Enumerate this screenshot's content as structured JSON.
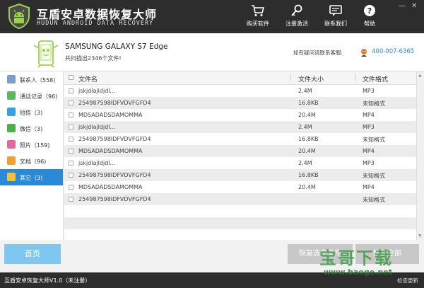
{
  "app": {
    "title_cn": "互盾安卓数据恢复大师",
    "title_en": "HUDUN ANDROID DATA RECOVERY"
  },
  "toolbar": {
    "buy": "购买软件",
    "register": "注册激活",
    "contact": "联系我们",
    "help": "帮助"
  },
  "device": {
    "name": "SAMSUNG  GALAXY S7 Edge",
    "scan_result": "共扫描出2346个文件!",
    "contact_label": "如有疑问请联系客服:",
    "phone": "400-007-6365"
  },
  "sidebar": {
    "items": [
      {
        "label": "联系人（558)",
        "icon": "contacts-icon",
        "color": "#7a9ec9"
      },
      {
        "label": "通话记录（96)",
        "icon": "phone-icon",
        "color": "#5cb85c"
      },
      {
        "label": "短信（3)",
        "icon": "sms-icon",
        "color": "#3aa0e0"
      },
      {
        "label": "微信（3)",
        "icon": "wechat-icon",
        "color": "#4cae4c"
      },
      {
        "label": "照片（159)",
        "icon": "photo-icon",
        "color": "#e06aa0"
      },
      {
        "label": "文档（96)",
        "icon": "document-icon",
        "color": "#f0a030"
      },
      {
        "label": "其它（3)",
        "icon": "other-icon",
        "color": "#f2c23a"
      }
    ],
    "active_index": 6
  },
  "table": {
    "headers": {
      "name": "文件名",
      "size": "文件大小",
      "format": "文件格式"
    },
    "rows": [
      {
        "name": "jskjdlajldjdl...",
        "size": "2.4M",
        "format": "MP3"
      },
      {
        "name": "254987598IDFVDVFGFD4",
        "size": "16.8KB",
        "format": "未知格式"
      },
      {
        "name": "MDSADADSDAMOMMA",
        "size": "20.4M",
        "format": "MP4"
      },
      {
        "name": "jskjdlajldjdl...",
        "size": "2.4M",
        "format": "MP3"
      },
      {
        "name": "254987598IDFVDVFGFD4",
        "size": "16.8KB",
        "format": "未知格式"
      },
      {
        "name": "MDSADADSDAMOMMA",
        "size": "20.4M",
        "format": "MP4"
      },
      {
        "name": "jskjdlajldjdl...",
        "size": "2.4M",
        "format": "MP3"
      },
      {
        "name": "254987598IDFVDVFGFD4",
        "size": "16.8KB",
        "format": "未知格式"
      },
      {
        "name": "MDSADADSDAMOMMA",
        "size": "20.4M",
        "format": "MP4"
      },
      {
        "name": "254987598IDFVDVFGFD4",
        "size": "",
        "format": "未知格式"
      },
      {
        "name": "",
        "size": "",
        "format": ""
      },
      {
        "name": "",
        "size": "",
        "format": ""
      }
    ]
  },
  "buttons": {
    "home": "首页",
    "recover_selected": "恢复选中文件",
    "recover_all": "恢复全部"
  },
  "status": {
    "version": "互盾安卓恢复大师V1.0（未注册）",
    "right": "检查更新"
  },
  "watermark": {
    "text": "宝哥下载",
    "url": "www.baoge.net"
  },
  "colors": {
    "header_bg": "#2d2d2d",
    "accent": "#2a8ad8",
    "home_button": "#7fc7f0"
  }
}
